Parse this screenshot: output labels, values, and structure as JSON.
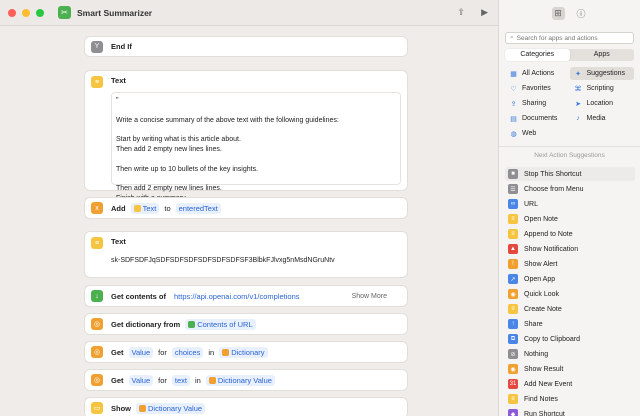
{
  "window": {
    "title": "Smart Summarizer",
    "traffic_colors": [
      "#ff5f57",
      "#febc2e",
      "#28c840"
    ]
  },
  "actions": {
    "end_if": {
      "label": "End If"
    },
    "text1": {
      "label": "Text",
      "body": "\"\n\nWrite a concise summary of the above text with the following guidelines:\n\nStart by writing what is this article about.\nThen add 2 empty new lines lines.\n\nThen write up to 10 bullets of the key insights.\n\nThen add 2 empty new lines lines.\nFinish with a summary."
    },
    "add": {
      "label": "Add",
      "token1": "Text",
      "word1": "to",
      "token2": "enteredText"
    },
    "text2": {
      "label": "Text",
      "body": "sk-SDFSDFJqSDFSDFSDFSDFSDFSDFSF3BlbkFJlvxg5nMsdNGruNtv"
    },
    "get_contents": {
      "label": "Get contents of",
      "url": "https://api.openai.com/v1/completions",
      "show_more": "Show More"
    },
    "get_dict": {
      "label": "Get dictionary from",
      "token": "Contents of URL"
    },
    "get_value1": {
      "label": "Get",
      "token1": "Value",
      "word1": "for",
      "token2": "choices",
      "word2": "in",
      "token3": "Dictionary"
    },
    "get_value2": {
      "label": "Get",
      "token1": "Value",
      "word1": "for",
      "token2": "text",
      "word2": "in",
      "token3": "Dictionary Value"
    },
    "show": {
      "label": "Show",
      "token": "Dictionary Value"
    }
  },
  "sidebar": {
    "search_placeholder": "Search for apps and actions",
    "segments": [
      "Categories",
      "Apps"
    ],
    "categories": [
      {
        "label": "All Actions",
        "icon": "grid-icon"
      },
      {
        "label": "Suggestions",
        "icon": "sparkles-icon"
      },
      {
        "label": "Favorites",
        "icon": "heart-icon"
      },
      {
        "label": "Scripting",
        "icon": "scripting-icon"
      },
      {
        "label": "Sharing",
        "icon": "share-icon"
      },
      {
        "label": "Location",
        "icon": "location-icon"
      },
      {
        "label": "Documents",
        "icon": "document-icon"
      },
      {
        "label": "Media",
        "icon": "music-icon"
      },
      {
        "label": "Web",
        "icon": "globe-icon"
      }
    ],
    "next_action_title": "Next Action Suggestions",
    "suggestions": [
      {
        "label": "Stop This Shortcut",
        "color": "#8e8e93",
        "glyph": "■"
      },
      {
        "label": "Choose from Menu",
        "color": "#8e8e93",
        "glyph": "☰"
      },
      {
        "label": "URL",
        "color": "#4a86e8",
        "glyph": "∞"
      },
      {
        "label": "Open Note",
        "color": "#f5c542",
        "glyph": "≡"
      },
      {
        "label": "Append to Note",
        "color": "#f5c542",
        "glyph": "≡"
      },
      {
        "label": "Show Notification",
        "color": "#e5483f",
        "glyph": "▲"
      },
      {
        "label": "Show Alert",
        "color": "#f0a030",
        "glyph": "!"
      },
      {
        "label": "Open App",
        "color": "#4a86e8",
        "glyph": "↗"
      },
      {
        "label": "Quick Look",
        "color": "#f0a030",
        "glyph": "◉"
      },
      {
        "label": "Create Note",
        "color": "#f5c542",
        "glyph": "≡"
      },
      {
        "label": "Share",
        "color": "#4a86e8",
        "glyph": "↑"
      },
      {
        "label": "Copy to Clipboard",
        "color": "#4a86e8",
        "glyph": "⧉"
      },
      {
        "label": "Nothing",
        "color": "#8e8e93",
        "glyph": "⊘"
      },
      {
        "label": "Show Result",
        "color": "#f0a030",
        "glyph": "◉"
      },
      {
        "label": "Add New Event",
        "color": "#e5483f",
        "glyph": "31"
      },
      {
        "label": "Find Notes",
        "color": "#f5c542",
        "glyph": "≡"
      },
      {
        "label": "Run Shortcut",
        "color": "#8e5bd8",
        "glyph": "◆"
      }
    ]
  }
}
